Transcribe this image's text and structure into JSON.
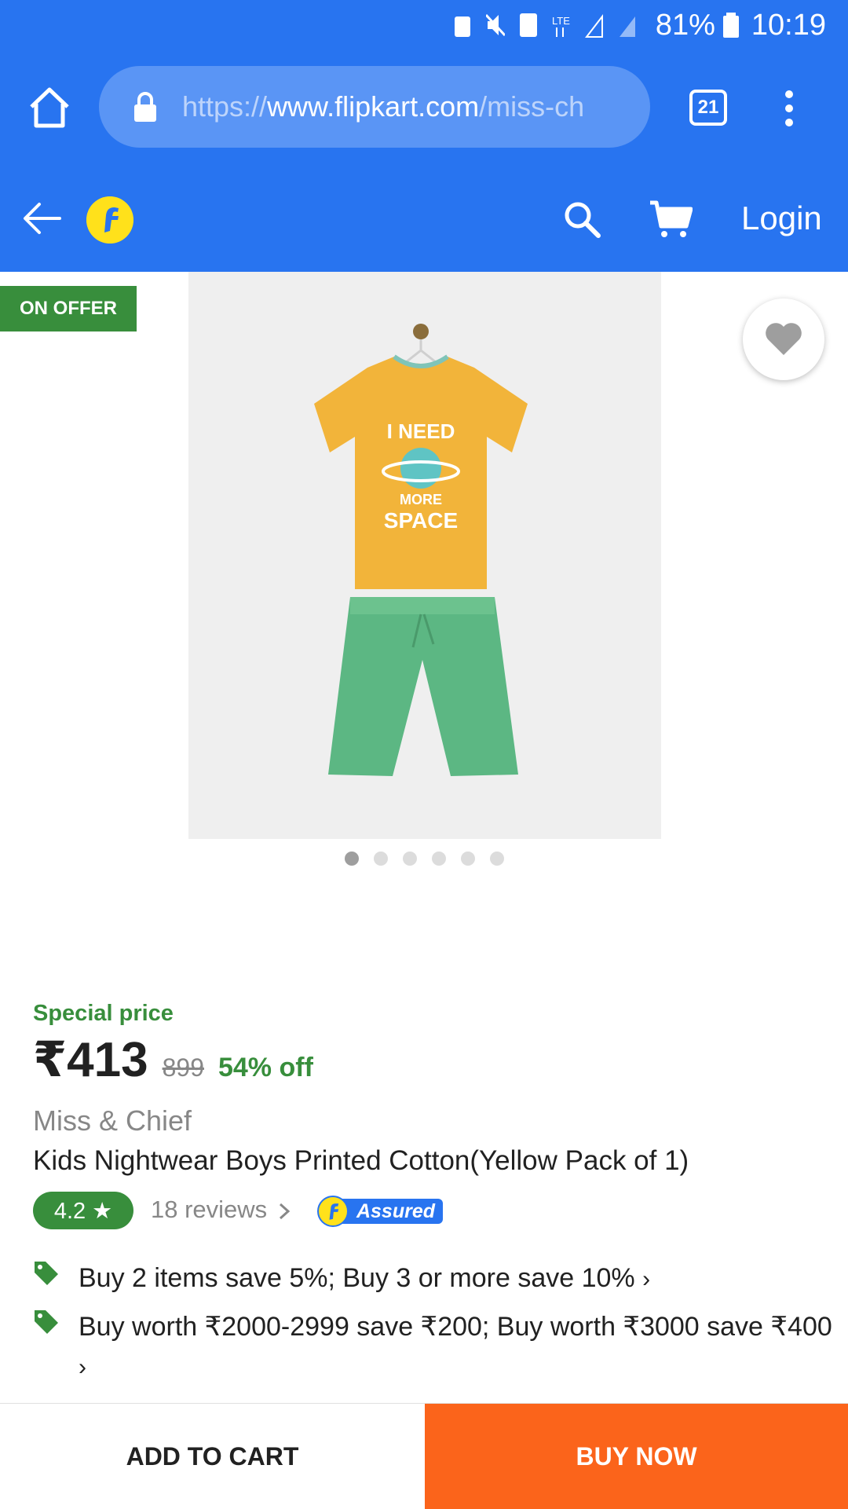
{
  "status_bar": {
    "battery": "81%",
    "time": "10:19",
    "icons": [
      "alarm-icon",
      "mute-icon",
      "sim-1-icon",
      "lte-icon",
      "signal-icon",
      "battery-icon"
    ]
  },
  "browser": {
    "url_scheme": "https://",
    "url_host": "www.flipkart.com",
    "url_path": "/miss-ch",
    "tab_count": "21",
    "icons": [
      "home-icon",
      "lock-icon",
      "tabs-icon",
      "menu-icon"
    ]
  },
  "app_bar": {
    "login_label": "Login",
    "icons": [
      "back-arrow-icon",
      "flipkart-logo",
      "search-icon",
      "cart-icon"
    ]
  },
  "product": {
    "offer_badge": "ON OFFER",
    "image_count": 6,
    "active_image": 1,
    "special_price_label": "Special price",
    "price": "₹413",
    "mrp": "899",
    "discount": "54% off",
    "brand": "Miss & Chief",
    "title": "Kids Nightwear Boys Printed Cotton(Yellow Pack of 1)",
    "rating": "4.2 ★",
    "reviews": "18 reviews",
    "assured_label": "Assured",
    "image_print_text": "I NEED MORE SPACE",
    "offers": [
      "Buy 2 items save 5%; Buy 3 or more save 10%",
      "Buy worth ₹2000-2999 save ₹200; Buy worth ₹3000 save ₹400"
    ]
  },
  "actions": {
    "add_to_cart": "ADD TO CART",
    "buy_now": "BUY NOW"
  },
  "colors": {
    "brand_blue": "#2874f0",
    "offer_green": "#388e3c",
    "buy_orange": "#fb641b",
    "logo_yellow": "#ffe11b"
  }
}
